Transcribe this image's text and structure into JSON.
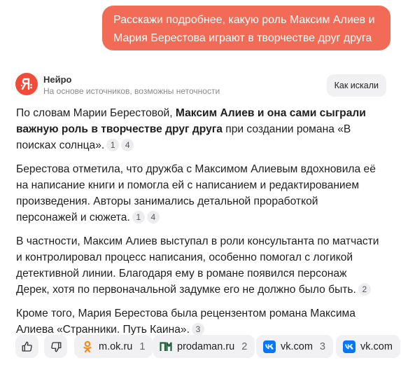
{
  "user_message": {
    "lines": [
      "Расскажи подробнее, какую роль Максим Алиев и",
      "Мария Берестова играют в творчестве друг друга"
    ]
  },
  "assistant": {
    "name": "Нейро",
    "subtitle": "На основе источников, возможны неточности",
    "how_button": "Как искали"
  },
  "answer": {
    "p1": {
      "l1_a": "По словам Марии Берестовой, ",
      "l1_b": "Максим Алиев и она сами сыграли",
      "l2_a": "важную роль в творчестве друг друга",
      "l2_b": " при создании романа «В",
      "l3": "поисках солнца».",
      "cites": [
        "1",
        "4"
      ]
    },
    "p2": {
      "lines": [
        "Берестова отметила, что дружба с Максимом Алиевым вдохновила её",
        "на написание книги и помогла ей с написанием и редактированием",
        "произведения. Авторы занимались детальной проработкой",
        "персонажей и сюжета."
      ],
      "cites": [
        "1",
        "4"
      ]
    },
    "p3": {
      "lines": [
        "В частности, Максим Алиев выступал в роли консультанта по матчасти",
        "и контролировал процесс написания, особенно помогал с логикой",
        "детективной линии. Благодаря ему в романе появился персонаж",
        "Дерек, хотя по первоначальной задумке его не должно было быть."
      ],
      "cites": [
        "2"
      ]
    },
    "p4": {
      "lines": [
        "Кроме того, Мария Берестова была рецензентом романа Максима",
        "Алиева «Странники. Путь Каина»."
      ],
      "cites": [
        "3"
      ]
    }
  },
  "sources": [
    {
      "name": "m.ok.ru",
      "count": "1",
      "icon": "ok-icon"
    },
    {
      "name": "prodaman.ru",
      "count": "2",
      "icon": "prodaman-icon"
    },
    {
      "name": "vk.com",
      "count": "3",
      "icon": "vk-icon"
    },
    {
      "name": "vk.com",
      "count": "",
      "icon": "vk-icon"
    }
  ],
  "colors": {
    "accent": "#f26b57",
    "logo": "#f24b3a",
    "chip_bg": "#f1f1f3",
    "ok": "#f28a1d",
    "vk": "#0077ff"
  }
}
